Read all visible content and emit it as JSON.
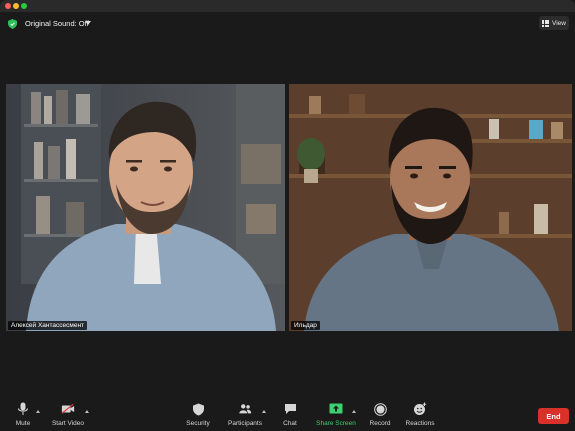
{
  "topbar": {
    "sound_label": "Original Sound: Off",
    "view_label": "View"
  },
  "participants": [
    {
      "name": "Алексей Хантассесмент"
    },
    {
      "name": "Ильдар"
    }
  ],
  "toolbar": {
    "mute": "Mute",
    "start_video": "Start Video",
    "security": "Security",
    "participants": "Participants",
    "chat": "Chat",
    "share_screen": "Share Screen",
    "record": "Record",
    "reactions": "Reactions",
    "end": "End"
  },
  "colors": {
    "active_speaker_border": "#f2e56b",
    "share_green": "#3cd070",
    "end_red": "#d9302a",
    "shield_green": "#2fbf5a"
  }
}
